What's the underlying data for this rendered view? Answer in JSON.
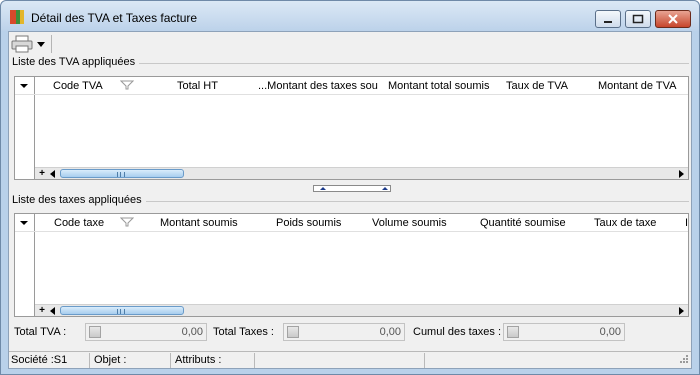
{
  "window": {
    "title": "Détail des TVA et Taxes facture"
  },
  "toolbar": {
    "print_icon": "printer-icon",
    "print_dropdown_icon": "chevron-down-icon"
  },
  "tva_section": {
    "label": "Liste des TVA appliquées",
    "columns": [
      "Code TVA",
      "Total HT",
      "...Montant des taxes sou",
      "Montant total soumis",
      "Taux de TVA",
      "Montant de TVA"
    ],
    "rows": []
  },
  "taxes_section": {
    "label": "Liste des taxes appliquées",
    "columns": [
      "Code taxe",
      "Montant soumis",
      "Poids soumis",
      "Volume soumis",
      "Quantité soumise",
      "Taux de taxe",
      "I"
    ],
    "rows": []
  },
  "totals": {
    "total_tva_label": "Total TVA :",
    "total_tva_value": "0,00",
    "total_taxes_label": "Total Taxes :",
    "total_taxes_value": "0,00",
    "cumul_taxes_label": "Cumul des taxes :",
    "cumul_taxes_value": "0,00"
  },
  "statusbar": {
    "societe": "Société :S1",
    "objet": "Objet :",
    "attributs": "Attributs :"
  },
  "colors": {
    "title_bar": "#bcd2ea",
    "scroll_thumb": "#a7cdee",
    "close_button": "#c7452b"
  }
}
